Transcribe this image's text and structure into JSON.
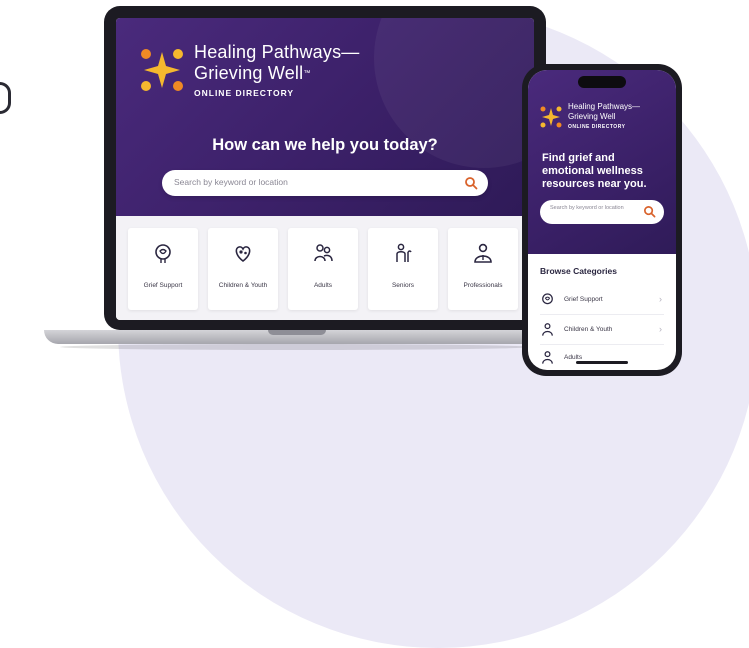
{
  "colors": {
    "brand_purple": "#3b2068",
    "logo_gold": "#f5b82e",
    "logo_orange": "#f08a24",
    "accent_orange": "#d9622b"
  },
  "laptop": {
    "brand_line1": "Healing Pathways—",
    "brand_line2": "Grieving Well",
    "brand_tm": "™",
    "brand_sub": "ONLINE DIRECTORY",
    "hero_title": "How can we help you today?",
    "search_placeholder": "Search by keyword or location",
    "categories": [
      {
        "icon": "grief-support-icon",
        "label": "Grief Support"
      },
      {
        "icon": "children-youth-icon",
        "label": "Children & Youth"
      },
      {
        "icon": "adults-icon",
        "label": "Adults"
      },
      {
        "icon": "seniors-icon",
        "label": "Seniors"
      },
      {
        "icon": "professionals-icon",
        "label": "Professionals"
      }
    ]
  },
  "phone": {
    "brand_line1": "Healing Pathways—",
    "brand_line2": "Grieving Well",
    "brand_sub": "ONLINE DIRECTORY",
    "title": "Find grief and emotional wellness resources near you.",
    "search_placeholder": "Search by keyword or location",
    "browse_heading": "Browse Categories",
    "items": [
      {
        "icon": "grief-support-icon",
        "label": "Grief Support"
      },
      {
        "icon": "children-youth-icon",
        "label": "Children & Youth"
      },
      {
        "icon": "adults-icon",
        "label": "Adults"
      }
    ]
  }
}
